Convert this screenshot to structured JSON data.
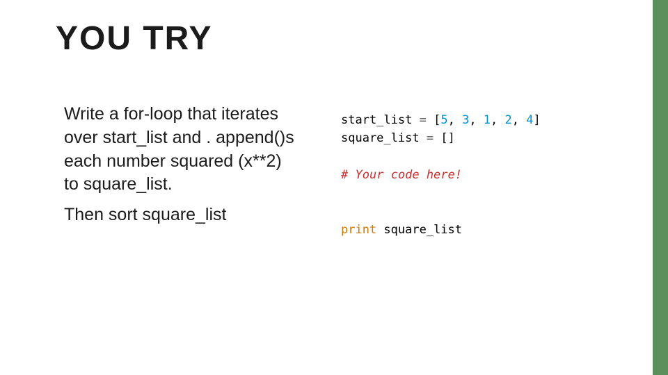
{
  "slide": {
    "title": "YOU TRY",
    "body_p1": "Write a for-loop that iterates over start_list and . append()s each number squared (x**2) to square_list.",
    "body_p2": "Then sort square_list"
  },
  "code": {
    "line1": {
      "var": "start_list",
      "eq": " = ",
      "lbr": "[",
      "n1": "5",
      "c1": ", ",
      "n2": "3",
      "c2": ", ",
      "n3": "1",
      "c3": ", ",
      "n4": "2",
      "c4": ", ",
      "n5": "4",
      "rbr": "]"
    },
    "line2": {
      "var": "square_list",
      "eq": " = ",
      "lbr": "[",
      "rbr": "]"
    },
    "comment": "# Your code here!",
    "print_kw": "print",
    "print_arg": " square_list"
  }
}
